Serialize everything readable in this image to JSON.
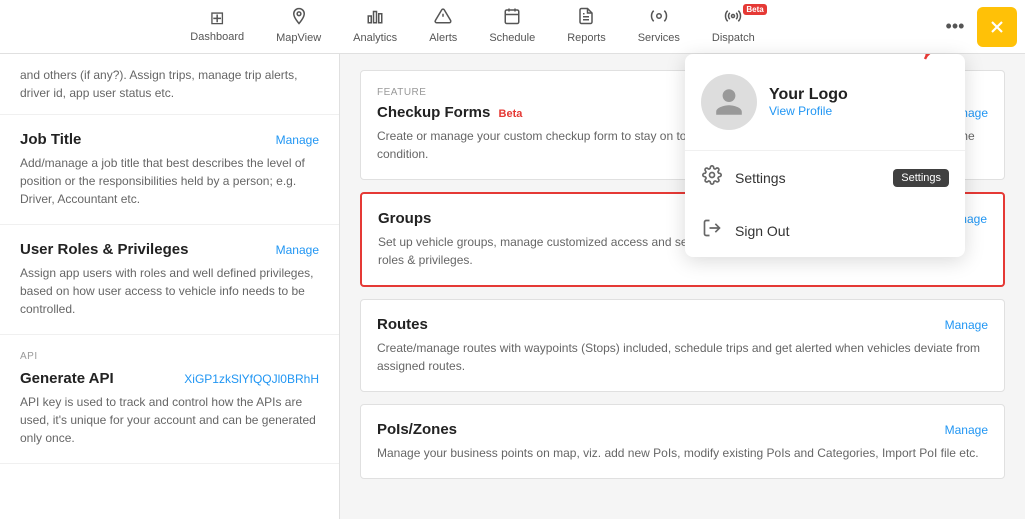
{
  "nav": {
    "items": [
      {
        "id": "dashboard",
        "label": "Dashboard",
        "icon": "⊞",
        "active": false
      },
      {
        "id": "mapview",
        "label": "MapView",
        "icon": "📍",
        "active": false
      },
      {
        "id": "analytics",
        "label": "Analytics",
        "icon": "📊",
        "active": false
      },
      {
        "id": "alerts",
        "label": "Alerts",
        "icon": "⚠",
        "active": false
      },
      {
        "id": "schedule",
        "label": "Schedule",
        "icon": "📅",
        "active": false
      },
      {
        "id": "reports",
        "label": "Reports",
        "icon": "📋",
        "active": false
      },
      {
        "id": "services",
        "label": "Services",
        "icon": "⚙",
        "active": false
      },
      {
        "id": "dispatch",
        "label": "Dispatch",
        "icon": "📡",
        "active": false,
        "beta": true
      }
    ],
    "three_dots_label": "•••",
    "yellow_btn_label": "✕✓"
  },
  "left_panel": {
    "partial_text": "and others (if any?). Assign trips, manage trip alerts, driver id, app user status etc.",
    "sections": [
      {
        "id": "job-title",
        "title": "Job Title",
        "manage_label": "Manage",
        "description": "Add/manage a job title that best describes the level of position or the responsibilities held by a person; e.g. Driver, Accountant etc."
      },
      {
        "id": "user-roles",
        "title": "User Roles & Privileges",
        "manage_label": "Manage",
        "description": "Assign app users with roles and well defined privileges, based on how user access to vehicle info needs to be controlled."
      }
    ],
    "api_section": {
      "tag": "API",
      "title": "Generate API",
      "api_key": "XiGP1zkSlYfQQJl0BRhH",
      "description": "API key is used to track and control how the APIs are used, it's unique for your account and can be generated only once."
    }
  },
  "right_panel": {
    "cards": [
      {
        "id": "checkup-forms",
        "tag": "FEATURE",
        "title": "Checkup Forms",
        "beta": true,
        "manage_label": "Manage",
        "description": "Create or manage your custom checkup form to stay on top of any maintenance your fleet needs to stay in prime condition.",
        "highlighted": false
      },
      {
        "id": "groups",
        "tag": "",
        "title": "Groups",
        "beta": false,
        "manage_label": "Manage",
        "description": "Set up vehicle groups, manage customized access and security levels to users in compliance with pre-defined roles & privileges.",
        "highlighted": true
      },
      {
        "id": "routes",
        "tag": "",
        "title": "Routes",
        "beta": false,
        "manage_label": "Manage",
        "description": "Create/manage routes with waypoints (Stops) included, schedule trips and get alerted when vehicles deviate from assigned routes.",
        "highlighted": false
      },
      {
        "id": "pois-zones",
        "tag": "",
        "title": "PoIs/Zones",
        "beta": false,
        "manage_label": "Manage",
        "description": "Manage your business points on map, viz. add new PoIs, modify existing PoIs and Categories, Import PoI file etc.",
        "highlighted": false
      }
    ]
  },
  "dropdown": {
    "logo_text": "Your Logo",
    "view_profile": "View Profile",
    "settings_label": "Settings",
    "settings_tooltip": "Settings",
    "signout_label": "Sign Out"
  }
}
